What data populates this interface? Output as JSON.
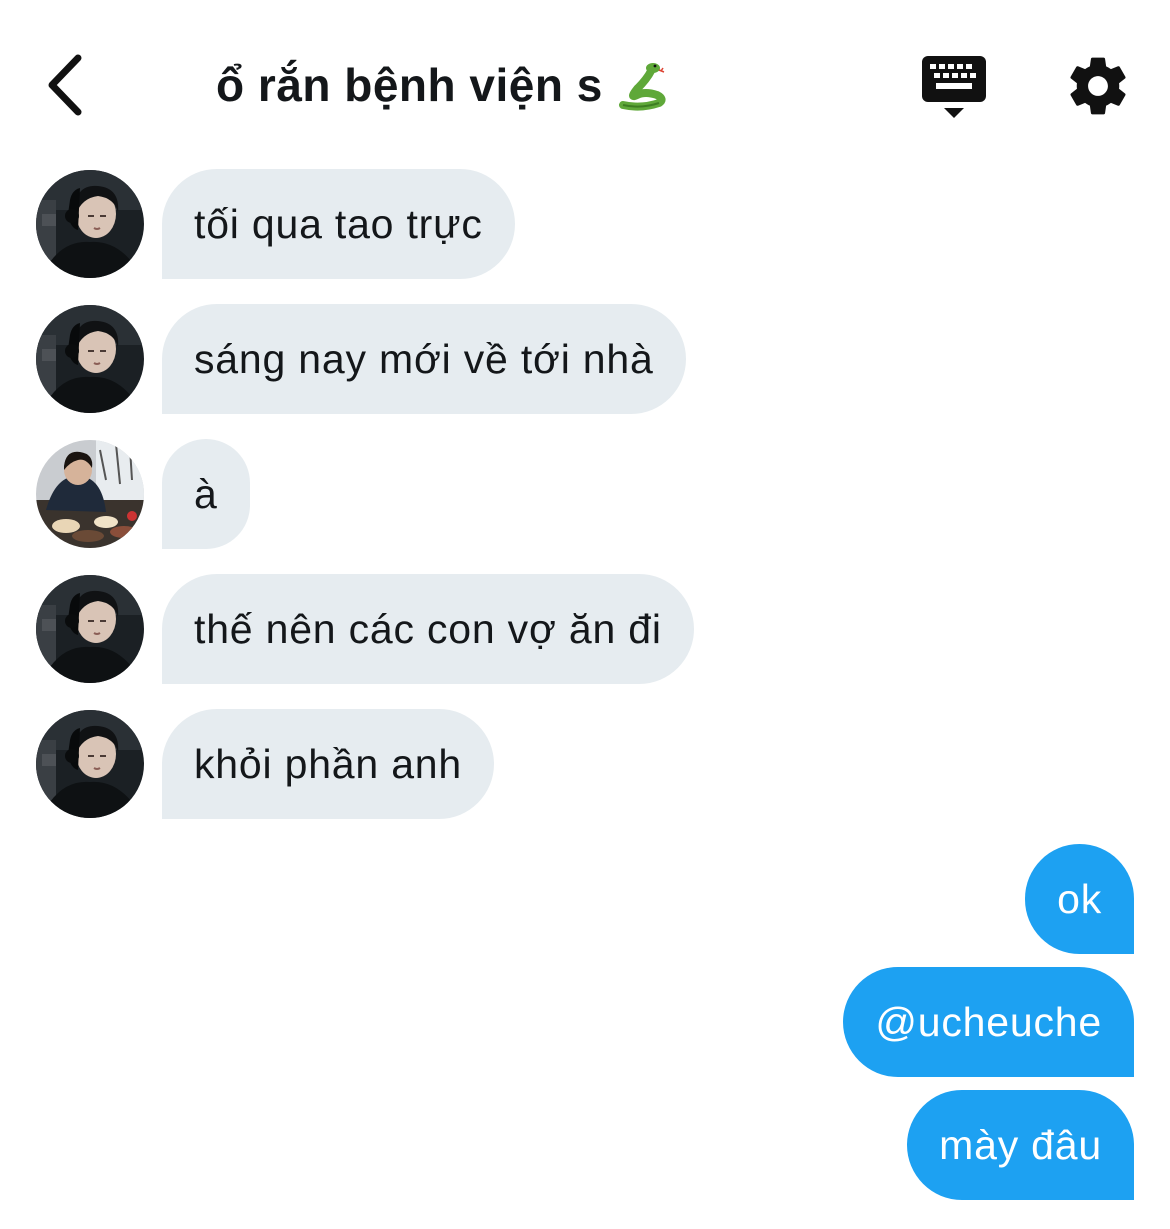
{
  "header": {
    "title": "ổ rắn bệnh viện s",
    "title_emoji": "snake-emoji",
    "back_icon": "chevron-left-icon",
    "keyboard_icon": "keyboard-icon",
    "settings_icon": "gear-icon"
  },
  "messages_in": [
    {
      "text": "tối qua tao trực",
      "avatar": "avatar-a"
    },
    {
      "text": "sáng nay mới về tới nhà",
      "avatar": "avatar-a"
    },
    {
      "text": "à",
      "avatar": "avatar-b"
    },
    {
      "text": "thế nên các con vợ ăn đi",
      "avatar": "avatar-a"
    },
    {
      "text": "khỏi phần anh",
      "avatar": "avatar-a"
    }
  ],
  "messages_out": [
    {
      "text": "ok"
    },
    {
      "text": "@ucheuche"
    },
    {
      "text": "mày đâu"
    }
  ],
  "colors": {
    "incoming_bubble": "#e6ecf0",
    "outgoing_bubble": "#1da1f2",
    "text": "#14171a",
    "outgoing_text": "#ffffff"
  }
}
